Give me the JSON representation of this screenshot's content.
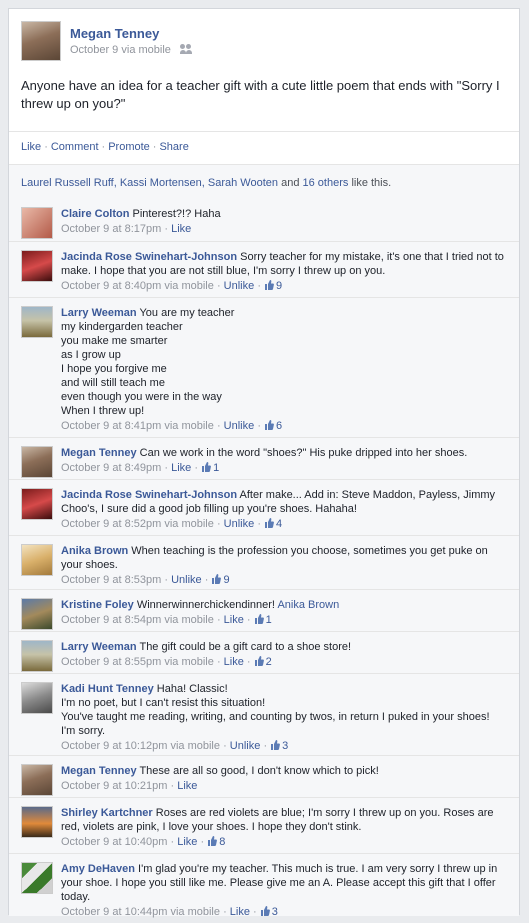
{
  "post": {
    "author": "Megan Tenney",
    "date": "October 9",
    "via": "via mobile",
    "text": "Anyone have an idea for a teacher gift with a cute little poem that ends with \"Sorry I threw up on you?\""
  },
  "actions": [
    "Like",
    "Comment",
    "Promote",
    "Share"
  ],
  "likes": {
    "names": "Laurel Russell Ruff, Kassi Mortensen, Sarah Wooten",
    "and": "and",
    "others": "16 others",
    "suffix": "like this."
  },
  "comments": [
    {
      "author": "Claire Colton",
      "text": "Pinterest?!? Haha",
      "time": "October 9 at 8:17pm",
      "via": "",
      "action": "Like",
      "count": ""
    },
    {
      "author": "Jacinda Rose Swinehart-Johnson",
      "text": "Sorry teacher for my mistake, it's one that I tried not to make. I hope that you are not still blue, I'm sorry I threw up on you.",
      "time": "October 9 at 8:40pm",
      "via": "via mobile",
      "action": "Unlike",
      "count": "9"
    },
    {
      "author": "Larry Weeman",
      "text": "You are my teacher\nmy kindergarden teacher\nyou make me smarter\nas I grow up\nI hope you forgive me\nand will still teach me\neven though you were in the way\nWhen I threw up!",
      "time": "October 9 at 8:41pm",
      "via": "via mobile",
      "action": "Unlike",
      "count": "6"
    },
    {
      "author": "Megan Tenney",
      "text": "Can we work in the word \"shoes?\" His puke dripped into her shoes.",
      "time": "October 9 at 8:49pm",
      "via": "",
      "action": "Like",
      "count": "1"
    },
    {
      "author": "Jacinda Rose Swinehart-Johnson",
      "text": "After make... Add in: Steve Maddon, Payless, Jimmy Choo's, I sure did a good job filling up you're shoes. Hahaha!",
      "time": "October 9 at 8:52pm",
      "via": "via mobile",
      "action": "Unlike",
      "count": "4"
    },
    {
      "author": "Anika Brown",
      "text": "When teaching is the profession you choose, sometimes you get puke on your shoes.",
      "time": "October 9 at 8:53pm",
      "via": "",
      "action": "Unlike",
      "count": "9"
    },
    {
      "author": "Kristine Foley",
      "text": "Winnerwinnerchickendinner!",
      "mention": "Anika Brown",
      "time": "October 9 at 8:54pm",
      "via": "via mobile",
      "action": "Like",
      "count": "1"
    },
    {
      "author": "Larry Weeman",
      "text": "The gift could be a gift card to a shoe store!",
      "time": "October 9 at 8:55pm",
      "via": "via mobile",
      "action": "Like",
      "count": "2"
    },
    {
      "author": "Kadi Hunt Tenney",
      "text": "Haha! Classic!\nI'm no poet, but I can't resist this situation!\nYou've taught me reading, writing, and counting by twos, in return I puked in your shoes!\nI'm sorry.",
      "time": "October 9 at 10:12pm",
      "via": "via mobile",
      "action": "Unlike",
      "count": "3"
    },
    {
      "author": "Megan Tenney",
      "text": "These are all so good, I don't know which to pick!",
      "time": "October 9 at 10:21pm",
      "via": "",
      "action": "Like",
      "count": ""
    },
    {
      "author": "Shirley Kartchner",
      "text": "Roses are red violets are blue; I'm sorry I threw up on you. Roses are red, violets are pink, I love your shoes. I hope they don't stink.",
      "time": "October 9 at 10:40pm",
      "via": "",
      "action": "Like",
      "count": "8"
    },
    {
      "author": "Amy DeHaven",
      "text": "I'm glad you're my teacher. This much is true. I am very sorry I threw up in your shoe. I hope you still like me. Please give me an A. Please accept this gift that I offer today.",
      "time": "October 9 at 10:44pm",
      "via": "via mobile",
      "action": "Like",
      "count": "3"
    }
  ],
  "colors": {
    "link": "#3b5998",
    "meta": "#90949c",
    "bg": "#f6f7f9"
  },
  "icons": {
    "audience": "people-icon",
    "like": "thumb-up-icon"
  }
}
